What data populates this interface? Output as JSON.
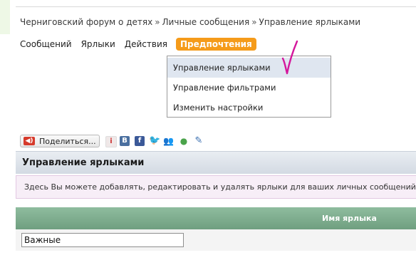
{
  "breadcrumb": {
    "items": [
      "Черниговский форум о детях",
      "Личные сообщения",
      "Управление ярлыками"
    ],
    "separator": "»"
  },
  "menu": {
    "items": [
      "Сообщений",
      "Ярлыки",
      "Действия",
      "Предпочтения"
    ],
    "active_color": "#f59b1a"
  },
  "dropdown": {
    "items": [
      "Управление ярлыками",
      "Управление фильтрами",
      "Изменить настройки"
    ]
  },
  "share": {
    "label": "Поделиться...",
    "icons": [
      "share-icon",
      "info-icon",
      "vk-icon",
      "facebook-icon",
      "twitter-icon",
      "people-icon",
      "friends-icon",
      "pencil-icon"
    ]
  },
  "section": {
    "title": "Управление ярлыками",
    "info": "Здесь Вы можете добавлять, редактировать и удалять ярлыки для ваших личных сообщений"
  },
  "table": {
    "column": "Имя ярлыка",
    "row_value": "Важные",
    "header_color": "#7faf8f"
  }
}
